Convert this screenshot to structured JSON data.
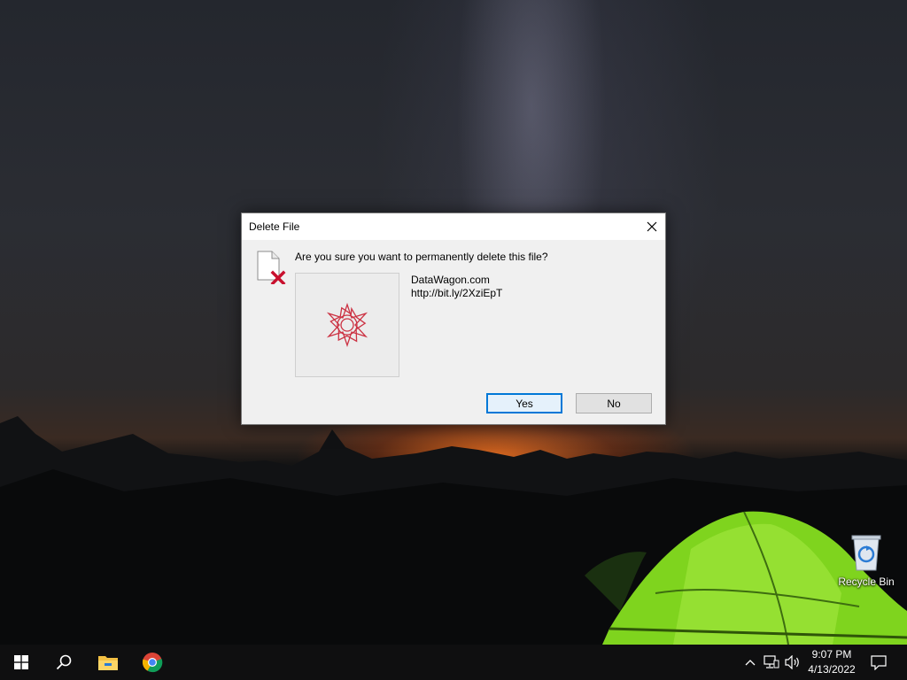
{
  "dialog": {
    "title": "Delete File",
    "question": "Are you sure you want to permanently delete this file?",
    "file_name": "DataWagon.com",
    "file_url": "http://bit.ly/2XziEpT",
    "yes_label": "Yes",
    "no_label": "No",
    "icons": {
      "close": "close-icon",
      "file_delete": "file-delete-icon",
      "thumbnail": "red-star-logo"
    }
  },
  "desktop": {
    "recycle_bin_label": "Recycle Bin"
  },
  "taskbar": {
    "icons": [
      "windows-start-icon",
      "search-icon",
      "file-explorer-icon",
      "chrome-icon"
    ],
    "tray_icons": [
      "chevron-up-icon",
      "network-icon",
      "volume-icon",
      "notifications-icon"
    ],
    "time": "9:07 PM",
    "date": "4/13/2022"
  },
  "colors": {
    "accent": "#0078d7",
    "delete_x": "#c8102e",
    "taskbar": "#0f0f10",
    "tent_green": "#7fd41e"
  }
}
